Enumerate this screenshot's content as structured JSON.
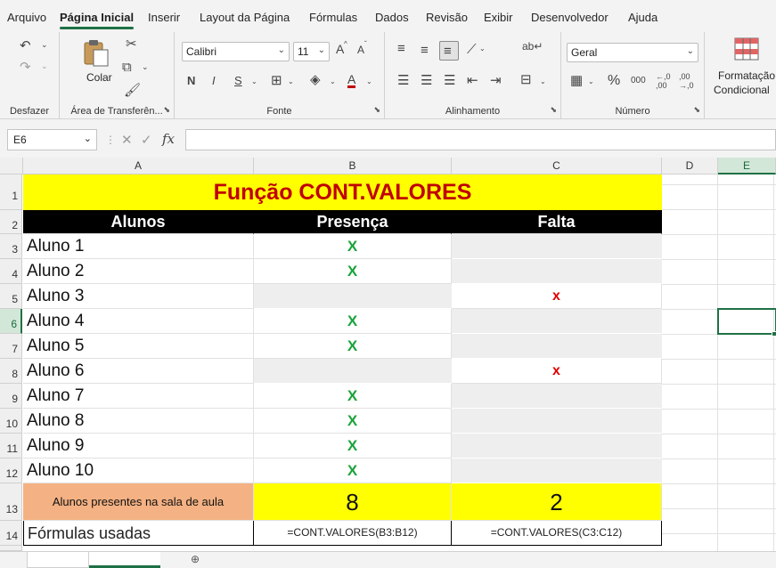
{
  "menu": {
    "tabs": [
      "Arquivo",
      "Página Inicial",
      "Inserir",
      "Layout da Página",
      "Fórmulas",
      "Dados",
      "Revisão",
      "Exibir",
      "Desenvolvedor",
      "Ajuda"
    ]
  },
  "ribbon": {
    "undo_group": "Desfazer",
    "clipboard_group": "Área de Transferên...",
    "paste_label": "Colar",
    "font_group": "Fonte",
    "font_name": "Calibri",
    "font_size": "11",
    "bold": "N",
    "italic": "I",
    "underline": "S",
    "grow_font": "A",
    "shrink_font": "A",
    "font_color_letter": "A",
    "alignment_group": "Alinhamento",
    "number_group": "Número",
    "number_format": "Geral",
    "percent": "%",
    "thousands": "000",
    "inc_decimal": "←,0 ,00",
    "dec_decimal": ",00 →,0",
    "conditional_format_line1": "Formatação",
    "conditional_format_line2": "Condicional"
  },
  "formula_bar": {
    "name_box": "E6",
    "formula": ""
  },
  "columns": [
    "A",
    "B",
    "C",
    "D",
    "E"
  ],
  "selected_cell": "E6",
  "sheet": {
    "title": "Função CONT.VALORES",
    "headers": [
      "Alunos",
      "Presença",
      "Falta"
    ],
    "rows": [
      {
        "row": "3",
        "name": "Aluno 1",
        "presence": "X",
        "absence": ""
      },
      {
        "row": "4",
        "name": "Aluno 2",
        "presence": "X",
        "absence": ""
      },
      {
        "row": "5",
        "name": "Aluno 3",
        "presence": "",
        "absence": "x"
      },
      {
        "row": "6",
        "name": "Aluno 4",
        "presence": "X",
        "absence": ""
      },
      {
        "row": "7",
        "name": "Aluno 5",
        "presence": "X",
        "absence": ""
      },
      {
        "row": "8",
        "name": "Aluno 6",
        "presence": "",
        "absence": "x"
      },
      {
        "row": "9",
        "name": "Aluno 7",
        "presence": "X",
        "absence": ""
      },
      {
        "row": "10",
        "name": "Aluno 8",
        "presence": "X",
        "absence": ""
      },
      {
        "row": "11",
        "name": "Aluno 9",
        "presence": "X",
        "absence": ""
      },
      {
        "row": "12",
        "name": "Aluno 10",
        "presence": "X",
        "absence": ""
      }
    ],
    "summary_label": "Alunos presentes na sala de aula",
    "summary_presence": "8",
    "summary_absence": "2",
    "formulas_label": "Fórmulas usadas",
    "formula_presence": "=CONT.VALORES(B3:B12)",
    "formula_absence": "=CONT.VALORES(C3:C12)",
    "row_numbers": [
      "1",
      "2",
      "13",
      "14"
    ]
  },
  "colors": {
    "accent": "#1f7145",
    "title_bg": "#ffff00",
    "title_text": "#c00000",
    "present_mark": "#1aa33a",
    "absent_mark": "#e00000",
    "summary_label_bg": "#f4b183"
  }
}
